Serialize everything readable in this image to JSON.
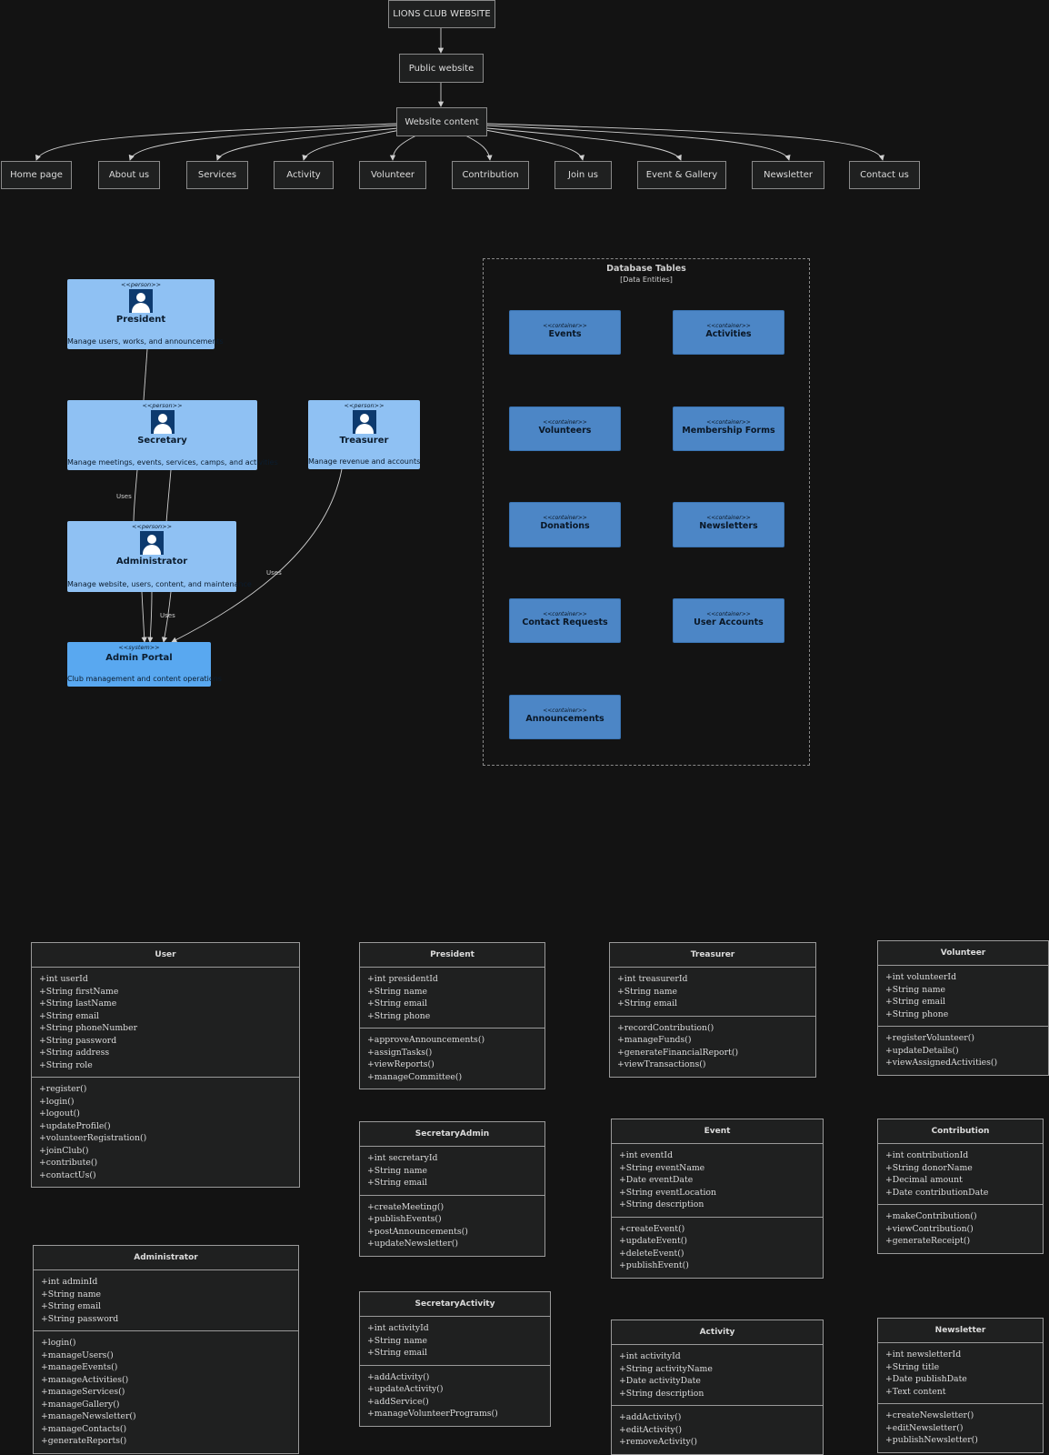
{
  "flowchart": {
    "root": "LIONS CLUB WEBSITE",
    "public": "Public website",
    "content": "Website content",
    "pages": [
      "Home page",
      "About us",
      "Services",
      "Activity",
      "Volunteer",
      "Contribution",
      "Join us",
      "Event & Gallery",
      "Newsletter",
      "Contact us"
    ]
  },
  "context": {
    "persons": [
      {
        "stereo": "<<person>>",
        "name": "President",
        "desc": "Manage users, works, and announcements"
      },
      {
        "stereo": "<<person>>",
        "name": "Secretary",
        "desc": "Manage meetings, events, services, camps, and activities"
      },
      {
        "stereo": "<<person>>",
        "name": "Treasurer",
        "desc": "Manage revenue and accounts"
      },
      {
        "stereo": "<<person>>",
        "name": "Administrator",
        "desc": "Manage website, users, content, and maintenance"
      }
    ],
    "system": {
      "stereo": "<<system>>",
      "name": "Admin Portal",
      "desc": "Club management and content operations"
    },
    "rel_labels": [
      "Uses",
      "Uses",
      "Uses"
    ],
    "boundary": {
      "title": "Database Tables",
      "subtitle": "[Data Entities]",
      "stereo": "<<container>>",
      "containers": [
        "Events",
        "Activities",
        "Volunteers",
        "Membership Forms",
        "Donations",
        "Newsletters",
        "Contact Requests",
        "User Accounts",
        "Announcements"
      ]
    }
  },
  "classes": [
    {
      "name": "User",
      "attrs": [
        "+int userId",
        "+String firstName",
        "+String lastName",
        "+String email",
        "+String phoneNumber",
        "+String password",
        "+String address",
        "+String role"
      ],
      "methods": [
        "+register()",
        "+login()",
        "+logout()",
        "+updateProfile()",
        "+volunteerRegistration()",
        "+joinClub()",
        "+contribute()",
        "+contactUs()"
      ]
    },
    {
      "name": "President",
      "attrs": [
        "+int presidentId",
        "+String name",
        "+String email",
        "+String phone"
      ],
      "methods": [
        "+approveAnnouncements()",
        "+assignTasks()",
        "+viewReports()",
        "+manageCommittee()"
      ]
    },
    {
      "name": "Treasurer",
      "attrs": [
        "+int treasurerId",
        "+String name",
        "+String email"
      ],
      "methods": [
        "+recordContribution()",
        "+manageFunds()",
        "+generateFinancialReport()",
        "+viewTransactions()"
      ]
    },
    {
      "name": "Volunteer",
      "attrs": [
        "+int volunteerId",
        "+String name",
        "+String email",
        "+String phone"
      ],
      "methods": [
        "+registerVolunteer()",
        "+updateDetails()",
        "+viewAssignedActivities()"
      ]
    },
    {
      "name": "SecretaryAdmin",
      "attrs": [
        "+int secretaryId",
        "+String name",
        "+String email"
      ],
      "methods": [
        "+createMeeting()",
        "+publishEvents()",
        "+postAnnouncements()",
        "+updateNewsletter()"
      ]
    },
    {
      "name": "Event",
      "attrs": [
        "+int eventId",
        "+String eventName",
        "+Date eventDate",
        "+String eventLocation",
        "+String description"
      ],
      "methods": [
        "+createEvent()",
        "+updateEvent()",
        "+deleteEvent()",
        "+publishEvent()"
      ]
    },
    {
      "name": "Contribution",
      "attrs": [
        "+int contributionId",
        "+String donorName",
        "+Decimal amount",
        "+Date contributionDate"
      ],
      "methods": [
        "+makeContribution()",
        "+viewContribution()",
        "+generateReceipt()"
      ]
    },
    {
      "name": "Administrator",
      "attrs": [
        "+int adminId",
        "+String name",
        "+String email",
        "+String password"
      ],
      "methods": [
        "+login()",
        "+manageUsers()",
        "+manageEvents()",
        "+manageActivities()",
        "+manageServices()",
        "+manageGallery()",
        "+manageNewsletter()",
        "+manageContacts()",
        "+generateReports()"
      ]
    },
    {
      "name": "SecretaryActivity",
      "attrs": [
        "+int activityId",
        "+String name",
        "+String email"
      ],
      "methods": [
        "+addActivity()",
        "+updateActivity()",
        "+addService()",
        "+manageVolunteerPrograms()"
      ]
    },
    {
      "name": "Activity",
      "attrs": [
        "+int activityId",
        "+String activityName",
        "+Date activityDate",
        "+String description"
      ],
      "methods": [
        "+addActivity()",
        "+editActivity()",
        "+removeActivity()"
      ]
    },
    {
      "name": "Newsletter",
      "attrs": [
        "+int newsletterId",
        "+String title",
        "+Date publishDate",
        "+Text content"
      ],
      "methods": [
        "+createNewsletter()",
        "+editNewsletter()",
        "+publishNewsletter()"
      ]
    }
  ]
}
